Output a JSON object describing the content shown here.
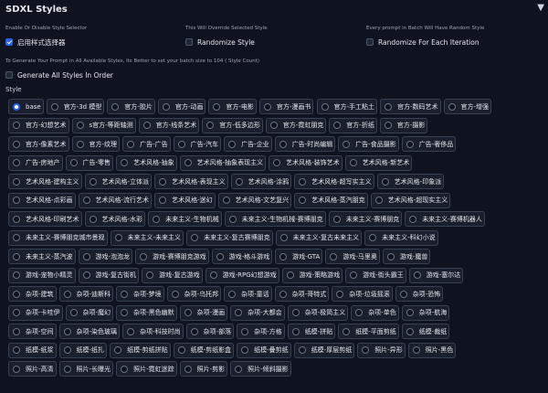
{
  "header": {
    "title": "SDXL Styles",
    "collapse_icon": "triangle-down-icon"
  },
  "options": [
    {
      "label": "Enable Or Disable Style Selector",
      "checkbox_label": "启用样式选择器",
      "checked": true
    },
    {
      "label": "This Will Override Selected Style",
      "checkbox_label": "Randomize Style",
      "checked": false
    },
    {
      "label": "Every prompt in Batch Will Have Random Style",
      "checkbox_label": "Randomize For Each Iteration",
      "checked": false
    }
  ],
  "info_text": "To Generate Your Prompt in All Available Styles, Its Better to set your batch size to 104 ( Style Count)",
  "generate_all": {
    "label": "Generate All Styles In Order",
    "checked": false
  },
  "style_label": "Style",
  "selected_style": "base",
  "style_rows": [
    [
      "base",
      "官方-3d 模型",
      "官方-胶片",
      "官方-动画",
      "官方-电影",
      "官方-漫画书",
      "官方-手工粘土",
      "官方-数码艺术",
      "官方-增强"
    ],
    [
      "官方-幻想艺术",
      "s官方-等距轴测",
      "官方-线条艺术",
      "官方-低多边形",
      "官方-霓虹朋克",
      "官方-折纸",
      "官方-摄影"
    ],
    [
      "官方-像素艺术",
      "官方-纹理",
      "广告-广告",
      "广告-汽车",
      "广告-企业",
      "广告-时尚编辑",
      "广告-食品摄影",
      "广告-奢侈品"
    ],
    [
      "广告-房地产",
      "广告-零售",
      "艺术风格-抽象",
      "艺术风格-抽象表现主义",
      "艺术风格-装饰艺术",
      "艺术风格-新艺术"
    ],
    [
      "艺术风格-建构主义",
      "艺术风格-立体派",
      "艺术风格-表现主义",
      "艺术风格-涂鸦",
      "艺术风格-超写实主义",
      "艺术风格-印象派"
    ],
    [
      "艺术风格-点彩画",
      "艺术风格-流行艺术",
      "艺术风格-迷幻",
      "艺术风格-文艺复兴",
      "艺术风格-蒸汽朋克",
      "艺术风格-超现实主义"
    ],
    [
      "艺术风格-印刷艺术",
      "艺术风格-水彩",
      "未来主义-生物机械",
      "未来主义-生物机械-赛博朋克",
      "未来主义-赛博朋克",
      "未来主义-赛博机器人"
    ],
    [
      "未来主义-赛博朋克城市景观",
      "未来主义-未来主义",
      "未来主义-复古赛博朋克",
      "未来主义-复古未来主义",
      "未来主义-科幻小说"
    ],
    [
      "未来主义-蒸汽波",
      "游戏-泡泡龙",
      "游戏-赛博朋克游戏",
      "游戏-格斗游戏",
      "游戏-GTA",
      "游戏-马里奥",
      "游戏-魔兽"
    ],
    [
      "游戏-宠物小精灵",
      "游戏-复古街机",
      "游戏-复古游戏",
      "游戏-RPG幻想游戏",
      "游戏-策略游戏",
      "游戏-街头霸王",
      "游戏-塞尔达"
    ],
    [
      "杂项-建筑",
      "杂项-迪斯科",
      "杂项-梦境",
      "杂项-乌托邦",
      "杂项-童话",
      "杂项-哥特式",
      "杂项-垃圾摇滚",
      "杂项-恐怖"
    ],
    [
      "杂项-卡哇伊",
      "杂项-魔幻",
      "杂项-黑色幽默",
      "杂项-漫画",
      "杂项-大都会",
      "杂项-极简主义",
      "杂项-单色",
      "杂项-航海"
    ],
    [
      "杂项-空间",
      "杂项-染色玻璃",
      "杂项-科技时尚",
      "杂项-部落",
      "杂项-方格",
      "纸模-拼贴",
      "纸模-平面剪纸",
      "纸模-裁纸"
    ],
    [
      "纸模-纸浆",
      "纸模-纸扎",
      "纸模-剪纸拼贴",
      "纸模-剪纸影盒",
      "纸模-叠剪纸",
      "纸模-厚层剪纸",
      "照片-异形",
      "照片-黑色"
    ],
    [
      "照片-高清",
      "照片-长曝光",
      "照片-霓虹迷踪",
      "照片-剪影",
      "照片-倾斜摄影"
    ]
  ]
}
